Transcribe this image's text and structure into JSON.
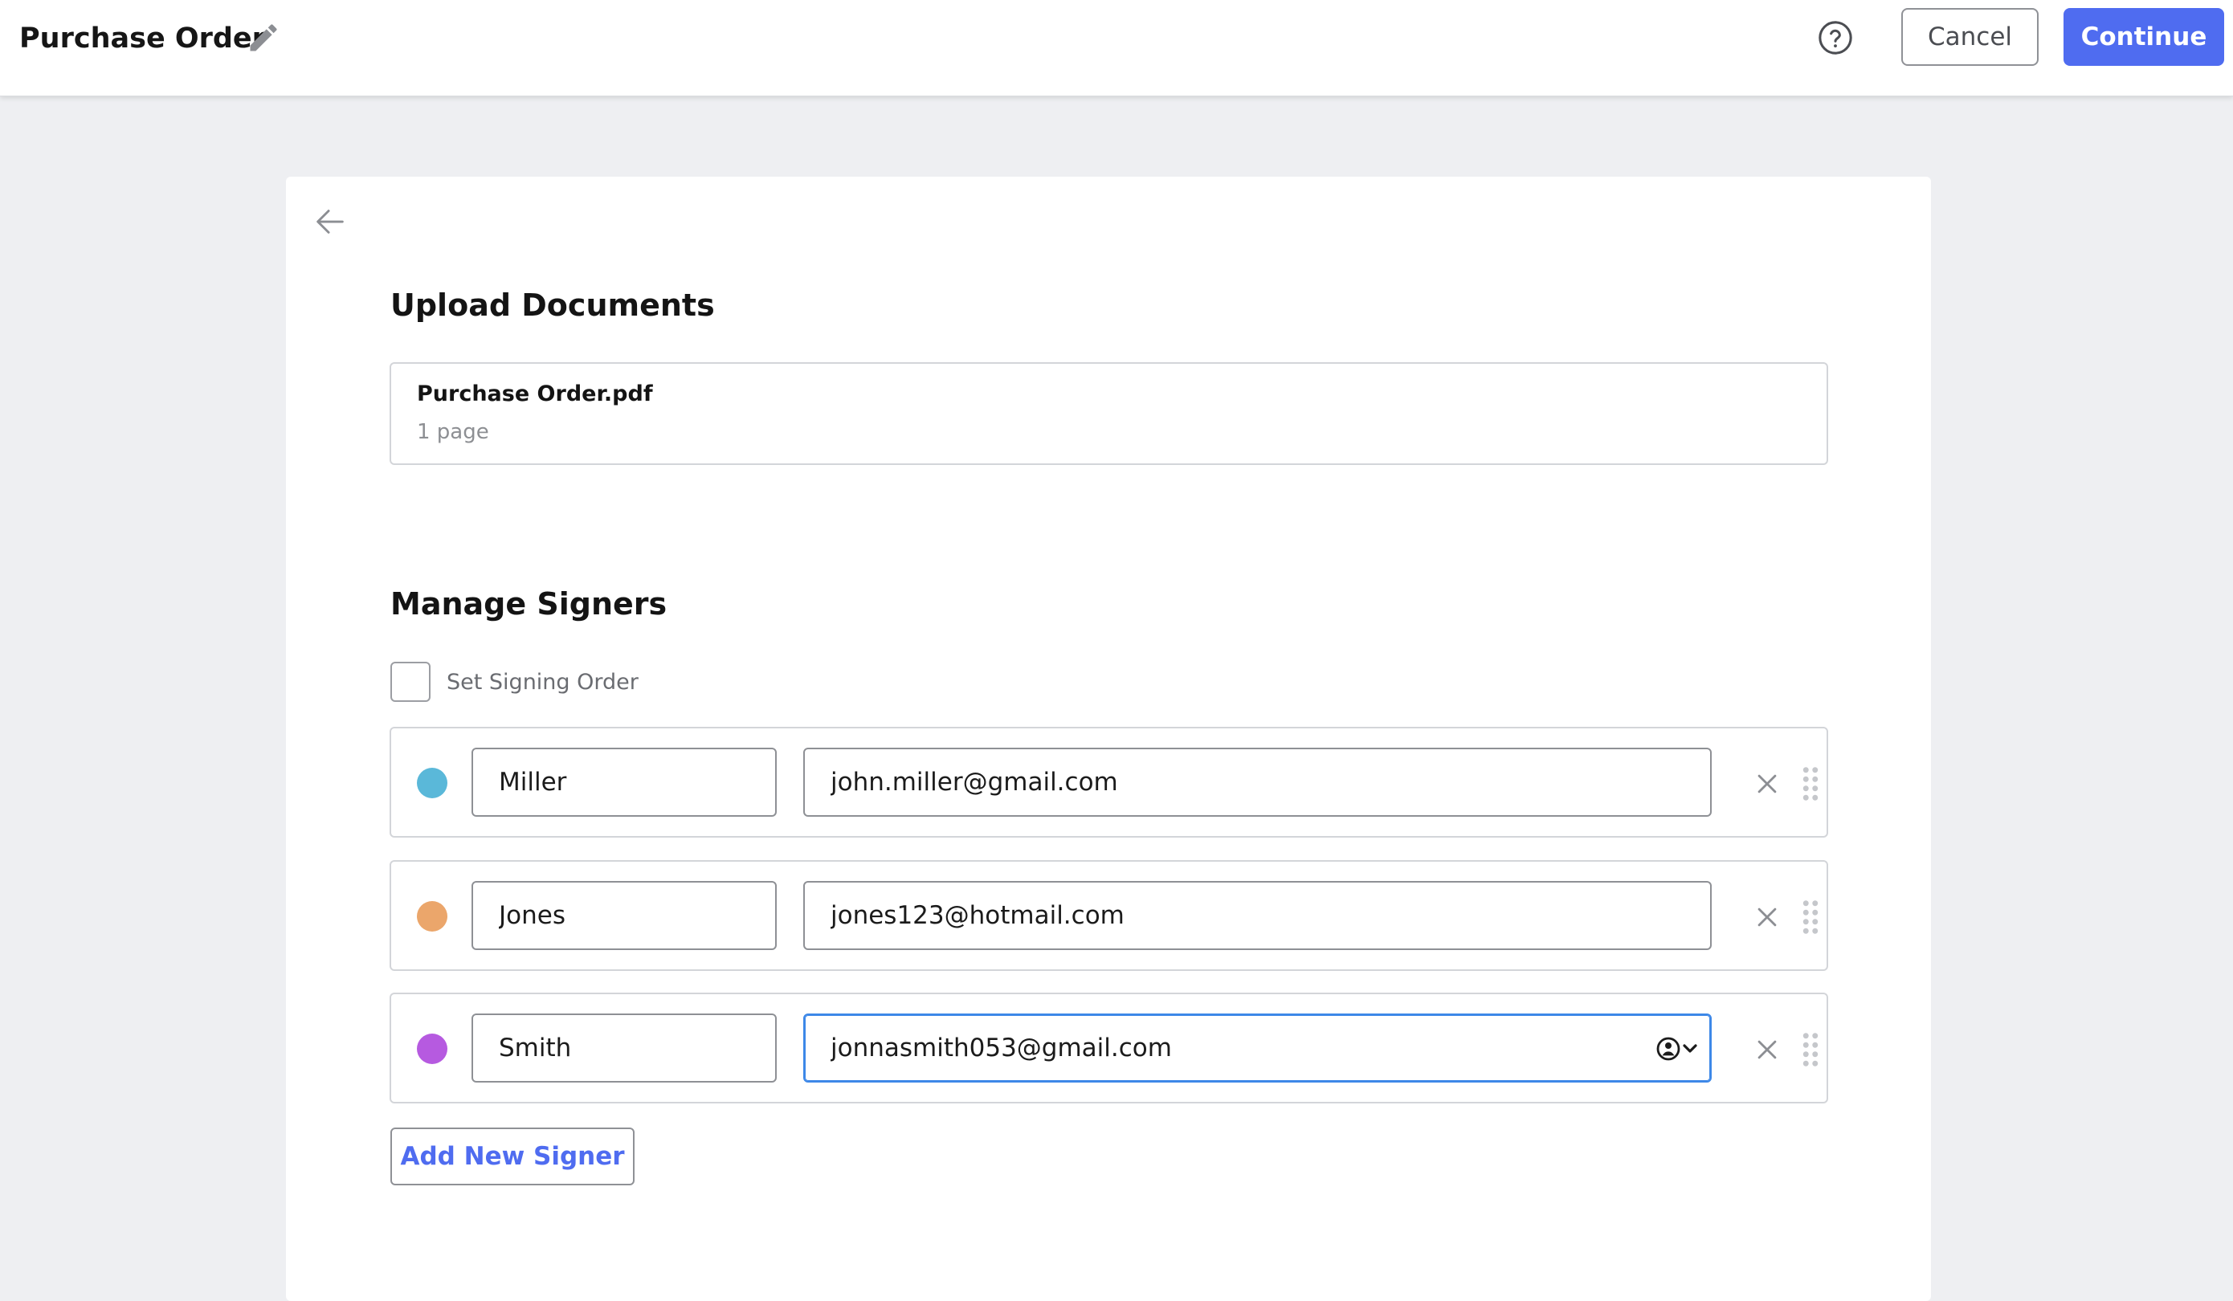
{
  "header": {
    "title": "Purchase Order",
    "edit_icon": "pencil-icon",
    "help_icon": "question-circle-icon",
    "cancel_label": "Cancel",
    "continue_label": "Continue"
  },
  "upload": {
    "title": "Upload Documents",
    "file_name": "Purchase Order.pdf",
    "file_pages": "1 page"
  },
  "signers": {
    "title": "Manage Signers",
    "signing_order_label": "Set Signing Order",
    "signing_order_checked": false,
    "items": [
      {
        "name": "Miller",
        "email": "john.miller@gmail.com",
        "color": "#5ab8d9"
      },
      {
        "name": "Jones",
        "email": "jones123@hotmail.com",
        "color": "#eba66b"
      },
      {
        "name": "Smith",
        "email": "jonnasmith053@gmail.com",
        "color": "#b65ae0"
      }
    ],
    "add_label": "Add New Signer"
  },
  "colors": {
    "accent": "#4f6cf0",
    "focus": "#3d88e8"
  }
}
